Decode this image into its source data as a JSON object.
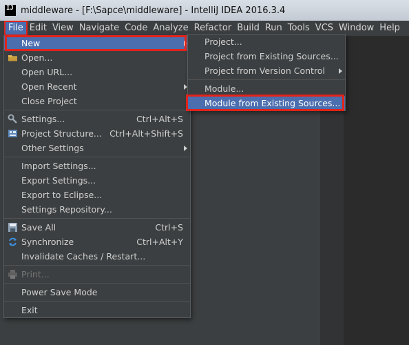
{
  "window": {
    "title": "middleware - [F:\\Sapce\\middleware] - IntelliJ IDEA 2016.3.4",
    "icon_text": "IJ"
  },
  "menubar": [
    "File",
    "Edit",
    "View",
    "Navigate",
    "Code",
    "Analyze",
    "Refactor",
    "Build",
    "Run",
    "Tools",
    "VCS",
    "Window",
    "Help"
  ],
  "file_menu": {
    "new": "New",
    "open": "Open...",
    "open_url": "Open URL...",
    "open_recent": "Open Recent",
    "close_project": "Close Project",
    "settings": "Settings...",
    "settings_sc": "Ctrl+Alt+S",
    "project_structure": "Project Structure...",
    "project_structure_sc": "Ctrl+Alt+Shift+S",
    "other_settings": "Other Settings",
    "import_settings": "Import Settings...",
    "export_settings": "Export Settings...",
    "export_eclipse": "Export to Eclipse...",
    "settings_repo": "Settings Repository...",
    "save_all": "Save All",
    "save_all_sc": "Ctrl+S",
    "synchronize": "Synchronize",
    "synchronize_sc": "Ctrl+Alt+Y",
    "invalidate": "Invalidate Caches / Restart...",
    "print": "Print...",
    "power_save": "Power Save Mode",
    "exit": "Exit"
  },
  "new_submenu": {
    "project": "Project...",
    "project_existing": "Project from Existing Sources...",
    "project_vcs": "Project from Version Control",
    "module": "Module...",
    "module_existing": "Module from Existing Sources..."
  },
  "colors": {
    "highlight": "#4b6eaf",
    "annotation": "#e2231a",
    "menu_bg": "#3c3f41"
  }
}
